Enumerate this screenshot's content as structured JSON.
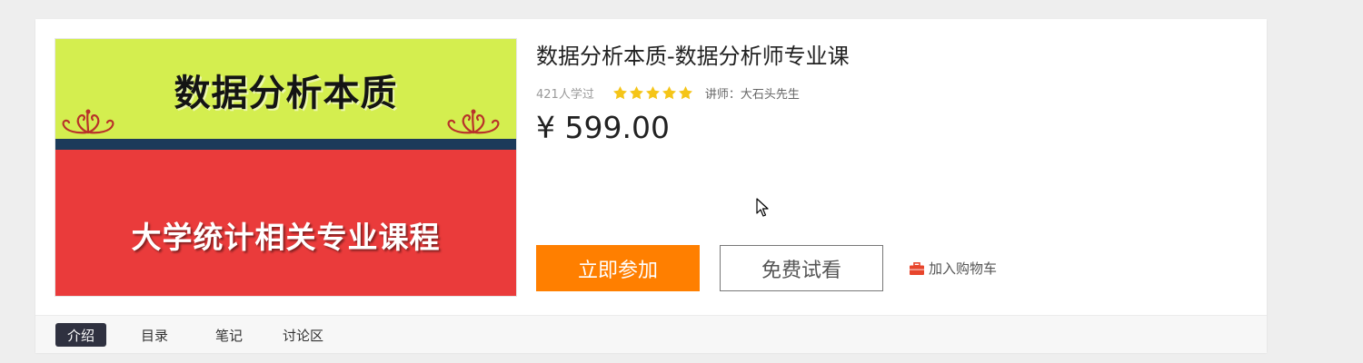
{
  "course": {
    "title": "数据分析本质-数据分析师专业课",
    "learners": "421人学过",
    "rating": 5,
    "teacher": "讲师：大石头先生",
    "price": "¥ 599.00"
  },
  "cover": {
    "title": "数据分析本质",
    "subtitle": "大学统计相关专业课程"
  },
  "actions": {
    "join_label": "立即参加",
    "trial_label": "免费试看",
    "cart_label": "加入购物车"
  },
  "tabs": [
    {
      "label": "介绍",
      "active": true
    },
    {
      "label": "目录",
      "active": false
    },
    {
      "label": "笔记",
      "active": false
    },
    {
      "label": "讨论区",
      "active": false
    }
  ],
  "colors": {
    "accent": "#ff7f00",
    "star": "#f5c518",
    "cart_icon": "#e8452c",
    "active_tab": "#2f3140"
  },
  "icons": {
    "star": "star-icon",
    "cart": "briefcase-cart-icon",
    "ornament": "scroll-ornament-icon",
    "cursor": "mouse-pointer-icon"
  }
}
